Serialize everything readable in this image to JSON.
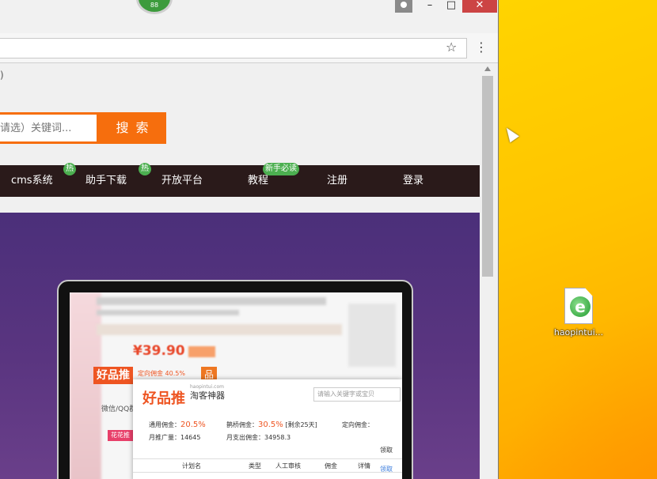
{
  "desktop": {
    "icon_label": "haopintui...",
    "icon_name": "ie-html-file-icon"
  },
  "window": {
    "badge_text": "88",
    "controls": {
      "minimize": "–",
      "maximize": "□",
      "close": "✕"
    }
  },
  "toolbar": {
    "bookmark_icon": "☆",
    "menu_icon": "⋮"
  },
  "page": {
    "top_text": ")",
    "search": {
      "placeholder": "请选）关键词...",
      "button_label": "搜 索"
    },
    "nav": [
      {
        "label": "cms系统",
        "badge": "热"
      },
      {
        "label": "助手下载",
        "badge": "热"
      },
      {
        "label": "开放平台",
        "badge": ""
      },
      {
        "label": "教程",
        "badge": "新手必读"
      },
      {
        "label": "注册",
        "badge": ""
      },
      {
        "label": "登录",
        "badge": ""
      }
    ],
    "hero": {
      "price": "¥39.90",
      "hpt_logo": "好品推",
      "hpt_ding": "定向佣金 40.5%",
      "hpt_pin": "品",
      "sub_left": "微信/QQ群",
      "pink_btn": "花花推",
      "panel": {
        "logo": "好品推",
        "logo_url": "haopintui.com",
        "logo_sub": "淘客神器",
        "search_placeholder": "请输入关键字或宝贝",
        "general_label": "通用佣金：",
        "general_value": "20.5%",
        "bridge_label": "鹊桥佣金：",
        "bridge_value": "30.5%",
        "bridge_note": "[剩余25天]",
        "directed_label": "定向佣金：",
        "monthly_label": "月推广量：",
        "monthly_value": "14645",
        "monthly_pay_label": "月支出佣金：",
        "monthly_pay_value": "34958.3",
        "columns": [
          "计划名",
          "类型",
          "人工审核",
          "佣金",
          "详情"
        ],
        "receive": "领取",
        "receive2": "领取"
      }
    }
  }
}
